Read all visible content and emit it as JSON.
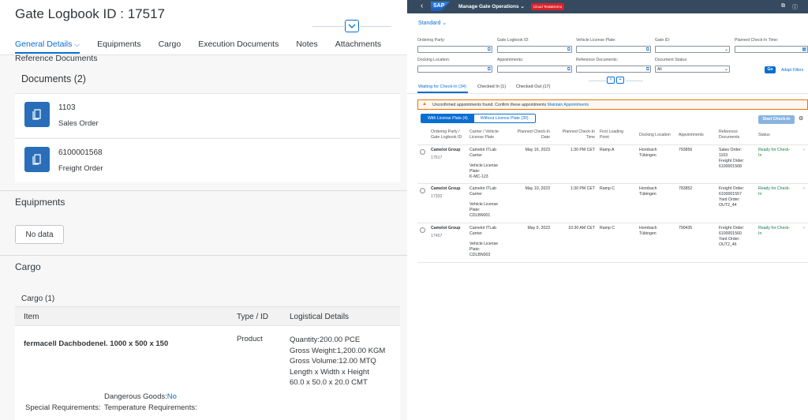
{
  "left": {
    "title": "Gate Logbook ID : 17517",
    "tabs": [
      "General Details",
      "Equipments",
      "Cargo",
      "Execution Documents",
      "Notes",
      "Attachments"
    ],
    "reference_documents_label": "Reference Documents",
    "documents_title": "Documents (2)",
    "documents": [
      {
        "number": "1103",
        "type": "Sales Order"
      },
      {
        "number": "6100001568",
        "type": "Freight Order"
      }
    ],
    "equipments_title": "Equipments",
    "no_data_label": "No data",
    "cargo_title": "Cargo",
    "cargo_subtitle": "Cargo (1)",
    "cargo_columns": [
      "Item",
      "Type / ID",
      "Logistical Details"
    ],
    "cargo_item": {
      "name": "fermacell Dachbodenel. 1000 x 500 x 150",
      "type": "Product",
      "quantity": "Quantity:200.00 PCE",
      "gross_weight": "Gross Weight:1,200.00 KGM",
      "gross_volume": "Gross Volume:12.00 MTQ",
      "dims_label": "Length x Width x Height",
      "dims_value": "60.0 x 50.0 x 20.0 CMT",
      "special_requirements_label": "Special Requirements:",
      "dangerous_goods_label": "Dangerous Goods:",
      "dangerous_goods_value": "No",
      "temperature_label": "Temperature Requirements:"
    }
  },
  "right": {
    "shell_title": "Manage Gate Operations",
    "shell_badge": "Cloud Test&Demo",
    "variant": "Standard",
    "filters": {
      "ordering_party": "Ordering Party:",
      "gate_logbook_id": "Gate Logbook ID:",
      "vehicle_license_plate": "Vehicle License Plate:",
      "gate_id": "Gate ID:",
      "planned_check_in_time": "Planned Check-In Time:",
      "docking_location": "Docking Location:",
      "appointments": "Appointments:",
      "reference_documents": "Reference Documents:",
      "document_status": "Document Status:",
      "document_status_value": "All",
      "go": "Go",
      "adapt_filters": "Adapt Filters"
    },
    "tabs": [
      "Waiting for Check-In (34)",
      "Checked In (1)",
      "Checked Out (17)"
    ],
    "warning_text": "Unconfirmed appointments found. Confirm these appointments",
    "warning_link": "Maintain Appointments",
    "segment": [
      "With License Plate (4)",
      "Without License Plate (30)"
    ],
    "start_check_in": "Start Check-In",
    "columns": {
      "c1a": "Ordering Party /",
      "c1b": "Gate Logbook ID",
      "c2a": "Carrier / Vehicle",
      "c2b": "License Plate",
      "c3a": "Planned Check-In",
      "c3b": "Date",
      "c4a": "Planned Check-In",
      "c4b": "Time",
      "c5a": "First Loading",
      "c5b": "Point",
      "c6": "Docking Location",
      "c7": "Appointments",
      "c8a": "Reference",
      "c8b": "Documents",
      "c9": "Status"
    },
    "rows": [
      {
        "party": "Camelot Group",
        "id": "17517",
        "carrier1": "Camelot ITLab",
        "carrier2": "Carrier",
        "plate_label1": "Vehicle License",
        "plate_label2": "Plate:",
        "plate": "K-MC-123",
        "date": "May 16, 2023",
        "time": "1:30 PM CET",
        "point": "Ramp A",
        "dock1": "Hornbach",
        "dock2": "Tübingen",
        "appt": "793856",
        "ref1": "Sales Order:",
        "ref2": "1103",
        "ref3": "Freight Order:",
        "ref4": "6100001568",
        "status1": "Ready for Check-",
        "status2": "In"
      },
      {
        "party": "Camelot Group",
        "id": "17332",
        "carrier1": "Camelot ITLab",
        "carrier2": "Carrier",
        "plate_label1": "Vehicle License",
        "plate_label2": "Plate:",
        "plate": "CDLBN001",
        "date": "May 10, 2023",
        "time": "1:30 PM CET",
        "point": "Ramp C",
        "dock1": "Hornbach",
        "dock2": "Tübingen",
        "appt": "783852",
        "ref1": "Freight Order:",
        "ref2": "6100001557",
        "ref3": "Yard Order:",
        "ref4": "OUT2_44",
        "status1": "Ready for Check-",
        "status2": "In"
      },
      {
        "party": "Camelot Group",
        "id": "17457",
        "carrier1": "Camelot ITLab",
        "carrier2": "Carrier",
        "plate_label1": "Vehicle License",
        "plate_label2": "Plate:",
        "plate": "CDLBN003",
        "date": "May 9, 2023",
        "time": "10:30 AM CET",
        "point": "Ramp C",
        "dock1": "Hornbach",
        "dock2": "Tübingen",
        "appt": "790435",
        "ref1": "Freight Order:",
        "ref2": "6100001560",
        "ref3": "Yard Order:",
        "ref4": "OUT2_46",
        "status1": "Ready for Check-",
        "status2": "In"
      }
    ]
  }
}
